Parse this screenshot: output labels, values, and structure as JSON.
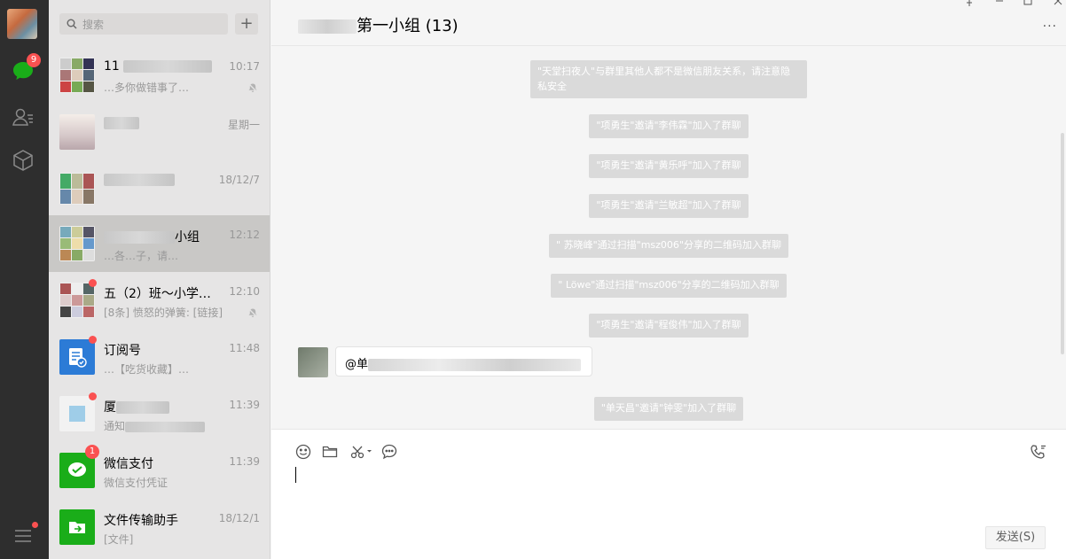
{
  "rail": {
    "unread_count": "9"
  },
  "search": {
    "placeholder": "搜索",
    "add_label": "+"
  },
  "conversations": [
    {
      "name": "11",
      "time": "10:17",
      "preview": "…多你做错事了…",
      "muted": true
    },
    {
      "name": "",
      "time": "星期一",
      "preview": ""
    },
    {
      "name": "",
      "time": "18/12/7",
      "preview": ""
    },
    {
      "name": "小组",
      "time": "12:12",
      "preview": "…各…子，请…",
      "selected": true
    },
    {
      "name": "五（2）班～小学同…",
      "time": "12:10",
      "preview": "[8条] 愤怒的弹簧: [链接]",
      "muted": true,
      "dot": true
    },
    {
      "name": "订阅号",
      "time": "11:48",
      "preview": "…【吃货收藏】…",
      "dot": true
    },
    {
      "name": "厦",
      "time": "11:39",
      "preview": "通知",
      "dot": true
    },
    {
      "name": "微信支付",
      "time": "11:39",
      "preview": "微信支付凭证",
      "unread": "1"
    },
    {
      "name": "文件传输助手",
      "time": "18/12/1",
      "preview": "[文件]"
    }
  ],
  "chat": {
    "title": "第一小组 (13)",
    "more": "···",
    "system_messages": [
      "\"天堂扫夜人\"与群里其他人都不是微信朋友关系，请注意隐私安全",
      "\"项勇生\"邀请\"李伟霖\"加入了群聊",
      "\"项勇生\"邀请\"黄乐呼\"加入了群聊",
      "\"项勇生\"邀请\"兰敏超\"加入了群聊",
      "\" 苏晓峰\"通过扫描\"msz006\"分享的二维码加入群聊",
      "\" Löwe\"通过扫描\"msz006\"分享的二维码加入群聊",
      "\"项勇生\"邀请\"程俊伟\"加入了群聊",
      "\"单天昌\"邀请\"钟雯\"加入了群聊"
    ],
    "bubble_text": "@单"
  },
  "composer": {
    "send_label": "发送(S)"
  },
  "colors": {
    "rail": "#2e2e2e",
    "list": "#e6e5e5",
    "badge": "#fa5151",
    "wechat_green": "#1aad19"
  }
}
